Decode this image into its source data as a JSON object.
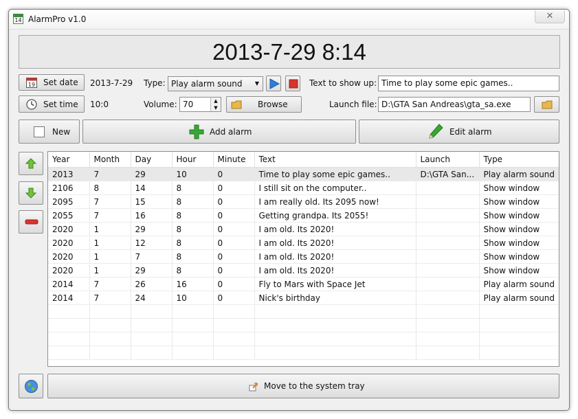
{
  "window": {
    "title": "AlarmPro v1.0",
    "icon_text": "14",
    "close_glyph": "✕"
  },
  "clock": {
    "text": "2013-7-29 8:14"
  },
  "controls": {
    "set_date_label": "Set date",
    "date_value": "2013-7-29",
    "set_time_label": "Set time",
    "time_value": "10:0",
    "type_label": "Type:",
    "type_selected": "Play alarm sound",
    "volume_label": "Volume:",
    "volume_value": "70",
    "browse_label": "Browse",
    "text_label": "Text to show up:",
    "text_value": "Time to play some epic games..",
    "launch_label": "Launch file:",
    "launch_value": "D:\\GTA San Andreas\\gta_sa.exe"
  },
  "actions": {
    "new_label": "New",
    "add_label": "Add alarm",
    "edit_label": "Edit alarm"
  },
  "table": {
    "columns": [
      "Year",
      "Month",
      "Day",
      "Hour",
      "Minute",
      "Text",
      "Launch",
      "Type"
    ],
    "rows": [
      [
        "2013",
        "7",
        "29",
        "10",
        "0",
        "Time to play some epic games..",
        "D:\\GTA San...",
        "Play alarm sound"
      ],
      [
        "2106",
        "8",
        "14",
        "8",
        "0",
        "I still sit on the computer..",
        "",
        "Show window"
      ],
      [
        "2095",
        "7",
        "15",
        "8",
        "0",
        "I am really old. Its 2095 now!",
        "",
        "Show window"
      ],
      [
        "2055",
        "7",
        "16",
        "8",
        "0",
        "Getting grandpa. Its 2055!",
        "",
        "Show window"
      ],
      [
        "2020",
        "1",
        "29",
        "8",
        "0",
        "I am old. Its 2020!",
        "",
        "Show window"
      ],
      [
        "2020",
        "1",
        "12",
        "8",
        "0",
        "I am old. Its 2020!",
        "",
        "Show window"
      ],
      [
        "2020",
        "1",
        "7",
        "8",
        "0",
        "I am old. Its 2020!",
        "",
        "Show window"
      ],
      [
        "2020",
        "1",
        "29",
        "8",
        "0",
        "I am old. Its 2020!",
        "",
        "Show window"
      ],
      [
        "2014",
        "7",
        "26",
        "16",
        "0",
        "Fly to Mars with Space Jet",
        "",
        "Play alarm sound"
      ],
      [
        "2014",
        "7",
        "24",
        "10",
        "0",
        "Nick's birthday",
        "",
        "Play alarm sound"
      ]
    ],
    "selected_row": 0,
    "empty_rows": 4
  },
  "footer": {
    "tray_label": "Move to the system tray"
  },
  "colors": {
    "green": "#3aa635",
    "red": "#d9342b",
    "blue": "#2d7fd6",
    "folder": "#e8b84a"
  }
}
